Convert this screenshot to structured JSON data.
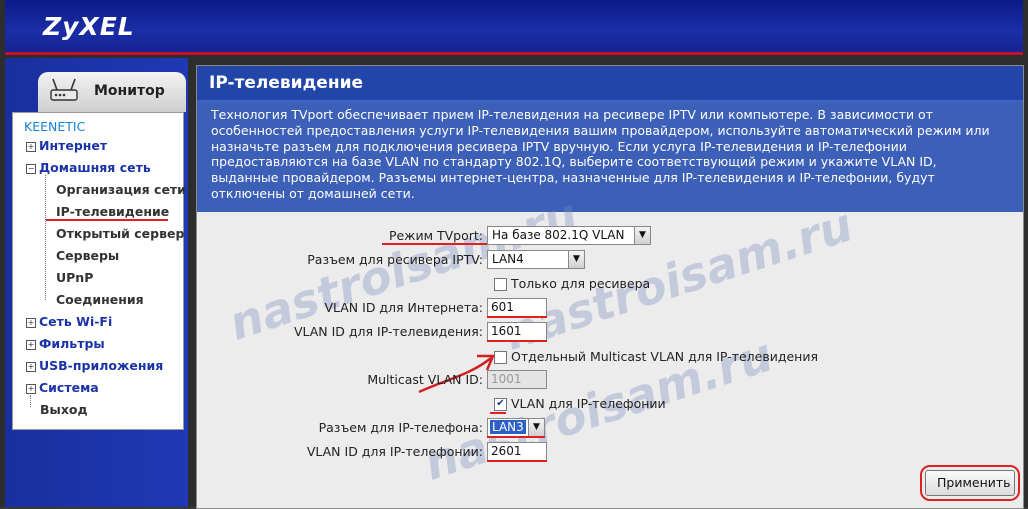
{
  "brand": {
    "logo": "ZyXEL"
  },
  "nav": {
    "monitor_tab": "Монитор",
    "device": "KEENETIC",
    "items": {
      "internet": "Интернет",
      "home": "Домашняя сеть",
      "org": "Организация сети",
      "iptv": "IP-телевидение",
      "open_server": "Открытый сервер",
      "servers": "Серверы",
      "upnp": "UPnP",
      "connections": "Соединения",
      "wifi": "Сеть Wi-Fi",
      "filters": "Фильтры",
      "usb": "USB-приложения",
      "system": "Система",
      "logout": "Выход"
    }
  },
  "page": {
    "title": "IP-телевидение",
    "description": "Технология TVport обеспечивает прием IP-телевидения на ресивере IPTV или компьютере. В зависимости от особенностей предоставления услуги IP-телевидения вашим провайдером, используйте автоматический режим или назначьте разъем для подключения ресивера IPTV вручную. Если услуга IP-телевидения и IP-телефонии предоставляются на базе VLAN по стандарту 802.1Q, выберите соответствующий режим и укажите VLAN ID, выданные провайдером. Разъемы интернет-центра, назначенные для IP-телевидения и IP-телефонии, будут отключены от домашней сети."
  },
  "form": {
    "tvport_label": "Режим TVport:",
    "tvport_value": "На базе 802.1Q VLAN",
    "receiver_port_label": "Разъем для ресивера IPTV:",
    "receiver_port_value": "LAN4",
    "receiver_only_label": "Только для ресивера",
    "receiver_only_checked": false,
    "vlan_internet_label": "VLAN ID для Интернета:",
    "vlan_internet_value": "601",
    "vlan_iptv_label": "VLAN ID для IP-телевидения:",
    "vlan_iptv_value": "1601",
    "multicast_cb_label": "Отдельный Multicast VLAN для IP-телевидения",
    "multicast_cb_checked": false,
    "multicast_label": "Multicast VLAN ID:",
    "multicast_value": "1001",
    "voip_cb_label": "VLAN для IP-телефонии",
    "voip_cb_checked": true,
    "phone_port_label": "Разъем для IP-телефона:",
    "phone_port_value": "LAN3",
    "vlan_phone_label": "VLAN ID для IP-телефонии:",
    "vlan_phone_value": "2601",
    "apply_label": "Применить"
  },
  "watermark": "nastroisam.ru",
  "colors": {
    "header_blue": "#1b2ea8",
    "accent_red": "#d22020",
    "link_blue": "#1a34a8"
  }
}
